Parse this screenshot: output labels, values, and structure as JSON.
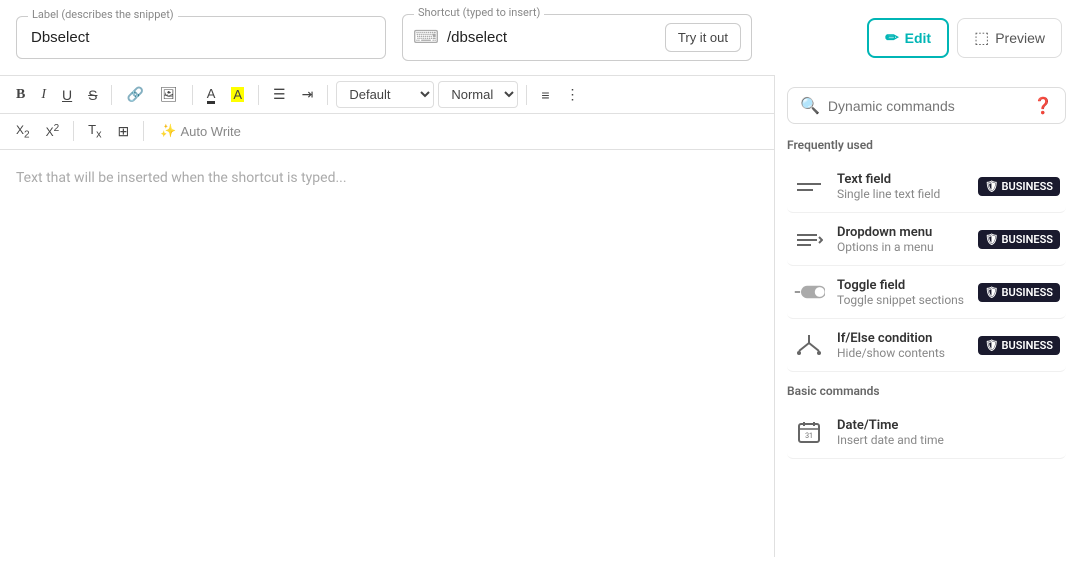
{
  "topBar": {
    "labelField": {
      "label": "Label (describes the snippet)",
      "value": "Dbselect",
      "placeholder": "Label (describes the snippet)"
    },
    "shortcutField": {
      "label": "Shortcut (typed to insert)",
      "value": "/dbselect",
      "placeholder": "Shortcut (typed to insert)"
    },
    "tryButton": "Try it out",
    "editButton": "Edit",
    "previewButton": "Preview"
  },
  "toolbar": {
    "bold": "B",
    "italic": "I",
    "underline": "U",
    "strike": "S",
    "defaultSelect": "Default",
    "normalSelect": "Normal",
    "autoWrite": "Auto Write",
    "subscript": "X₂",
    "superscript": "X²",
    "clearFormat": "Tx"
  },
  "editor": {
    "placeholder": "Text that will be inserted when the shortcut is typed..."
  },
  "sidebar": {
    "searchPlaceholder": "Dynamic commands",
    "frequentlyUsed": "Frequently used",
    "basicCommands": "Basic commands",
    "commands": [
      {
        "name": "Text field",
        "desc": "Single line text field",
        "icon": "text-field",
        "badge": "BUSINESS"
      },
      {
        "name": "Dropdown menu",
        "desc": "Options in a menu",
        "icon": "dropdown-menu",
        "badge": "BUSINESS"
      },
      {
        "name": "Toggle field",
        "desc": "Toggle snippet sections",
        "icon": "toggle-field",
        "badge": "BUSINESS"
      },
      {
        "name": "If/Else condition",
        "desc": "Hide/show contents",
        "icon": "if-else",
        "badge": "BUSINESS"
      }
    ],
    "basicCommandsList": [
      {
        "name": "Date/Time",
        "desc": "Insert date and time",
        "icon": "date-time",
        "badge": null
      }
    ]
  }
}
